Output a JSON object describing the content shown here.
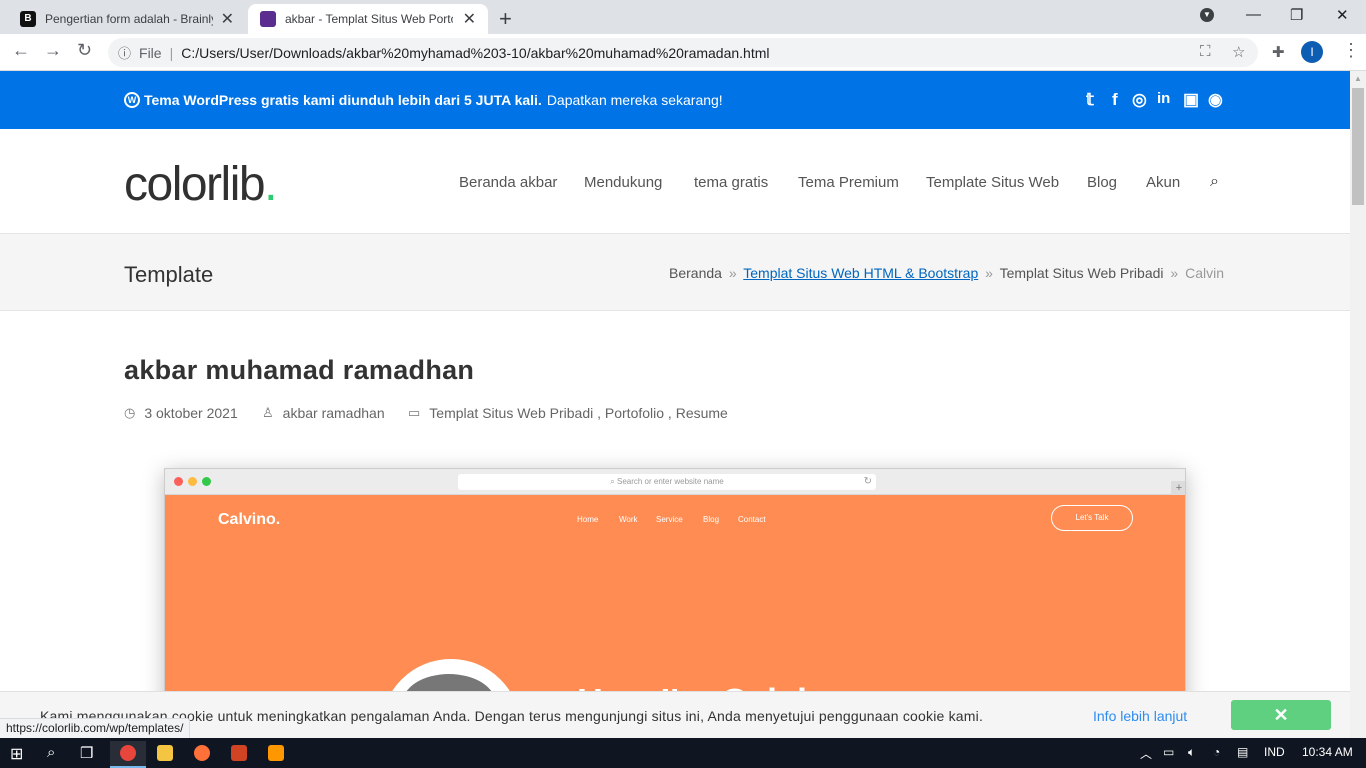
{
  "browser": {
    "tabs": [
      {
        "title": "Pengertian form adalah - Brainly.co.id"
      },
      {
        "title": "akbar - Templat Situs Web Portofolio"
      }
    ],
    "url_scheme": "File",
    "url": "C:/Users/User/Downloads/akbar%20myhamad%203-10/akbar%20muhamad%20ramadan.html",
    "profile_initial": "I",
    "status_url": "https://colorlib.com/wp/templates/"
  },
  "topbar": {
    "bold": "Tema WordPress gratis kami diunduh lebih dari 5 JUTA kali.",
    "cta": "Dapatkan mereka sekarang!"
  },
  "site": {
    "logo": "colorlib",
    "logo_dot": ".",
    "menu": [
      "Beranda akbar",
      "Mendukung",
      "tema gratis",
      "Tema Premium",
      "Template Situs Web",
      "Blog",
      "Akun"
    ]
  },
  "page_header": {
    "title": "Template",
    "breadcrumb": {
      "home": "Beranda",
      "link": "Templat Situs Web HTML & Bootstrap",
      "section": "Templat Situs Web Pribadi",
      "current": "Calvin",
      "separator": "»"
    }
  },
  "post": {
    "title": "akbar muhamad ramadhan",
    "date": "3 oktober 2021",
    "author": "akbar ramadhan",
    "categories": "Templat Situs Web Pribadi , Portofolio , Resume"
  },
  "mockup": {
    "url_placeholder": "Search or enter website name",
    "brand": "Calvino.",
    "nav": [
      "Home",
      "Work",
      "Service",
      "Blog",
      "Contact"
    ],
    "cta": "Let's Talk",
    "hero_text": "Hey, I'm Calvin"
  },
  "cookie": {
    "message": "Kami menggunakan cookie untuk meningkatkan pengalaman Anda. Dengan terus mengunjungi situs ini, Anda menyetujui penggunaan cookie kami.",
    "info_link": "Info lebih lanjut",
    "close": "✕"
  },
  "taskbar": {
    "language": "IND",
    "time": "10:34 AM"
  },
  "colors": {
    "topbar": "#0073e6",
    "accent_green": "#2ecc71",
    "mockup_orange": "#ff8c52",
    "cookie_button": "#5fcf80"
  }
}
